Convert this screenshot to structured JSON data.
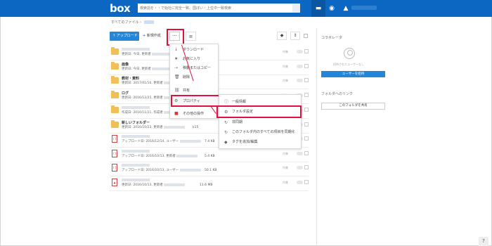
{
  "topbar": {
    "logo": "box",
    "search_placeholder": "検索語を・・で始社に完全一致、国ぼい・上位中一致検索"
  },
  "breadcrumb": {
    "root": "すべてのファイル",
    "separator": "›"
  },
  "toolbar": {
    "upload_label": "↑ アップロード",
    "new_label": "+ 新規作成",
    "more_label": "···",
    "sort_label": "≡"
  },
  "rows": [
    {
      "type": "folder",
      "name": "",
      "meta": "更新日: 今日, 更新者",
      "size": "",
      "right": "作集"
    },
    {
      "type": "folder",
      "name": "画像",
      "meta": "更新日: 今日, 更新者",
      "size": "",
      "right": "作集"
    },
    {
      "type": "folder",
      "name": "教材・資料",
      "meta": "更新日: 2017/01/10, 更新者",
      "size": "",
      "right": "作集"
    },
    {
      "type": "folder",
      "name": "ログ",
      "meta": "更新日: 2016/12/25, 更新者",
      "size": "",
      "right": "作集"
    },
    {
      "type": "folder",
      "name": "",
      "meta": "作成日: 2016/11/21, 作成者",
      "size": "",
      "right": "作集"
    },
    {
      "type": "folder",
      "name": "新しいフォルダー",
      "meta": "更新日: 2016/10/23, 更新者",
      "size": "k15",
      "right": "作集"
    },
    {
      "type": "doc",
      "name": "",
      "meta": "アップロード日: 2016/12/14, ユーザー",
      "size": "7.4 KB",
      "right": "作集"
    },
    {
      "type": "doc",
      "name": "",
      "meta": "アップロード日: 2016/10/13, 更新者",
      "size": "5.4 KB",
      "right": "作集"
    },
    {
      "type": "doc",
      "name": "",
      "meta": "アップロード日: 2016/10/13, ユーザー",
      "size": "50.1 KB",
      "right": "作集"
    },
    {
      "type": "pdf",
      "name": "",
      "meta": "更新日: 2016/10/13, 更新者",
      "size": "11.6 MB",
      "right": "作集"
    }
  ],
  "menu1": {
    "items": [
      {
        "icon": "↓",
        "label": "ダウンロード"
      },
      {
        "icon": "★",
        "label": "お気に入り"
      },
      {
        "icon": "⇢",
        "label": "移動またはコピー"
      },
      {
        "icon": "🗑",
        "label": "削除"
      },
      {
        "icon": "⛓",
        "label": "共有"
      },
      {
        "icon": "⚙",
        "label": "プロパティ"
      },
      {
        "icon": "■",
        "label": "その他の操作"
      }
    ]
  },
  "menu2": {
    "items": [
      {
        "icon": "ⓘ",
        "label": "一般情報"
      },
      {
        "icon": "⚙",
        "label": "フォルダ設定"
      },
      {
        "icon": "↻",
        "label": "非同期"
      },
      {
        "icon": "↻",
        "label": "このフォルダ内のすべての項目を同期化"
      },
      {
        "icon": "◆",
        "label": "タグを追加/編集"
      }
    ]
  },
  "sidebar": {
    "collaborators_title": "コラボレータ",
    "no_collab_note": "招待されたユーザーなし",
    "invite_button": "ユーザーを招待",
    "link_title": "フォルダへのリンク",
    "share_button": "このフォルダを共有"
  },
  "help_label": "?"
}
